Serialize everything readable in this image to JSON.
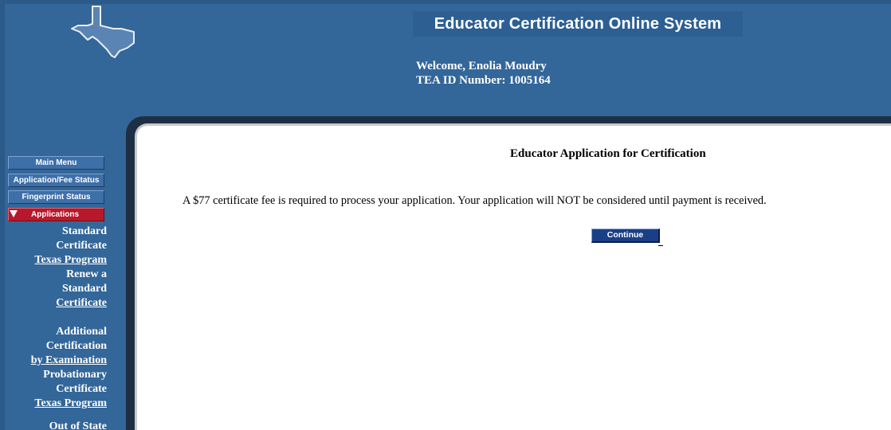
{
  "header": {
    "system_title": "Educator Certification Online System",
    "welcome": "Welcome, Enolia Moudry",
    "tea_id": "TEA ID Number: 1005164",
    "logo_icon": "texas-state-outline-icon"
  },
  "sidebar": {
    "menu": {
      "main_menu": "Main Menu",
      "application_fee_status": "Application/Fee Status",
      "fingerprint_status": "Fingerprint Status",
      "applications": "Applications"
    },
    "applications_arrow_icon": "triangle-down-icon",
    "links": {
      "standard": [
        "Standard",
        "Certificate",
        "Texas Program"
      ],
      "renew": [
        "Renew a",
        "Standard",
        "Certificate"
      ],
      "additional": [
        "Additional",
        "Certification",
        "by Examination"
      ],
      "probationary": [
        "Probationary",
        "Certificate",
        "Texas Program"
      ],
      "out_of_state": [
        "Out of State"
      ]
    }
  },
  "main": {
    "heading": "Educator Application for Certification",
    "fee_message": "A $77 certificate fee is required to process your application. Your application will NOT be considered until payment is received.",
    "continue_label": "Continue"
  },
  "colors": {
    "header_blue": "#336699",
    "menu_button": "#3d6fa8",
    "active_menu": "#b7182b",
    "continue_button": "#1a3f86"
  }
}
